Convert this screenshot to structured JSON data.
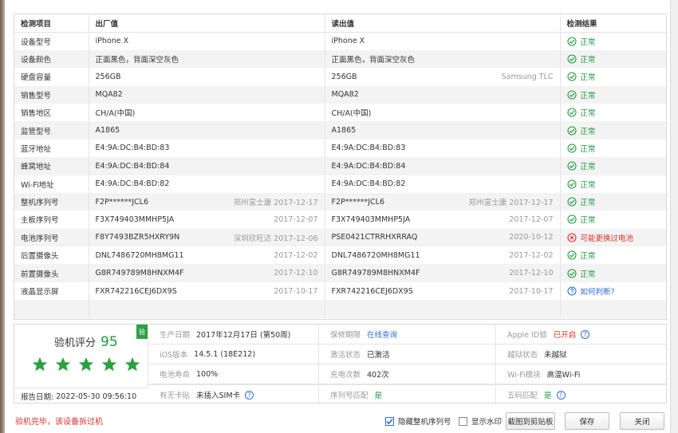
{
  "table": {
    "headers": [
      "检测项目",
      "出厂值",
      "读出值",
      "检测结果"
    ],
    "rows": [
      {
        "item": "设备型号",
        "factory": "iPhone X",
        "factory_note": "",
        "read": "iPhone X",
        "read_note": "",
        "result": "正常",
        "status": "ok"
      },
      {
        "item": "设备颜色",
        "factory": "正面黑色，背面深空灰色",
        "factory_note": "",
        "read": "正面黑色，背面深空灰色",
        "read_note": "",
        "result": "正常",
        "status": "ok"
      },
      {
        "item": "硬盘容量",
        "factory": "256GB",
        "factory_note": "",
        "read": "256GB",
        "read_note": "Samsung TLC",
        "result": "正常",
        "status": "ok"
      },
      {
        "item": "销售型号",
        "factory": "MQA82",
        "factory_note": "",
        "read": "MQA82",
        "read_note": "",
        "result": "正常",
        "status": "ok"
      },
      {
        "item": "销售地区",
        "factory": "CH/A(中国)",
        "factory_note": "",
        "read": "CH/A(中国)",
        "read_note": "",
        "result": "正常",
        "status": "ok"
      },
      {
        "item": "监管型号",
        "factory": "A1865",
        "factory_note": "",
        "read": "A1865",
        "read_note": "",
        "result": "正常",
        "status": "ok"
      },
      {
        "item": "蓝牙地址",
        "factory": "E4:9A:DC:B4:BD:83",
        "factory_note": "",
        "read": "E4:9A:DC:B4:BD:83",
        "read_note": "",
        "result": "正常",
        "status": "ok"
      },
      {
        "item": "蜂窝地址",
        "factory": "E4:9A:DC:B4:BD:84",
        "factory_note": "",
        "read": "E4:9A:DC:B4:BD:84",
        "read_note": "",
        "result": "正常",
        "status": "ok"
      },
      {
        "item": "Wi-Fi地址",
        "factory": "E4:9A:DC:B4:BD:82",
        "factory_note": "",
        "read": "E4:9A:DC:B4:BD:82",
        "read_note": "",
        "result": "正常",
        "status": "ok"
      },
      {
        "item": "整机序列号",
        "factory": "F2P******JCL6",
        "factory_note": "郑州富士康 2017-12-17",
        "read": "F2P******JCL6",
        "read_note": "郑州富士康 2017-12-17",
        "result": "正常",
        "status": "ok"
      },
      {
        "item": "主板序列号",
        "factory": "F3X749403MMHP5JA",
        "factory_note": "2017-12-07",
        "read": "F3X749403MMHP5JA",
        "read_note": "2017-12-07",
        "result": "正常",
        "status": "ok"
      },
      {
        "item": "电池序列号",
        "factory": "F8Y7493BZR5HXRY9N",
        "factory_note": "深圳欣旺达 2017-12-06",
        "read": "PSE0421CTRRHXRRAQ",
        "read_note": "2020-10-12",
        "result": "可能更换过电池",
        "status": "bad"
      },
      {
        "item": "后置摄像头",
        "factory": "DNL7486720MH8MG11",
        "factory_note": "2017-12-02",
        "read": "DNL7486720MH8MG11",
        "read_note": "2017-12-02",
        "result": "正常",
        "status": "ok"
      },
      {
        "item": "前置摄像头",
        "factory": "G8R749789M8HNXM4F",
        "factory_note": "2017-12-10",
        "read": "G8R749789M8HNXM4F",
        "read_note": "2017-12-10",
        "result": "正常",
        "status": "ok"
      },
      {
        "item": "液晶显示屏",
        "factory": "FXR742216CEJ6DX9S",
        "factory_note": "2017-10-17",
        "read": "FXR742216CEJ6DX9S",
        "read_note": "2017-10-17",
        "result": "如何判断?",
        "status": "ask"
      }
    ]
  },
  "score": {
    "label": "验机评分",
    "value": "95",
    "stars": 5,
    "badge": "验"
  },
  "report": {
    "label": "报告日期:",
    "value": "2022-05-30 09:56:10"
  },
  "info": {
    "row1": [
      {
        "key": "生产日期",
        "value": "2017年12月17日 (第50周)",
        "style": ""
      },
      {
        "key": "保修期限",
        "value": "在线查询",
        "style": "blue"
      },
      {
        "key": "Apple ID锁",
        "value": "已开启",
        "style": "red"
      }
    ],
    "row2": [
      {
        "key": "iOS版本",
        "value": "14.5.1 (18E212)",
        "style": ""
      },
      {
        "key": "激活状态",
        "value": "已激活",
        "style": ""
      },
      {
        "key": "越狱状态",
        "value": "未越狱",
        "style": ""
      }
    ],
    "row3": [
      {
        "key": "电池寿命",
        "value": "100%",
        "style": ""
      },
      {
        "key": "充电次数",
        "value": "402次",
        "style": ""
      },
      {
        "key": "Wi-Fi模块",
        "value": "高温Wi-Fi",
        "style": ""
      }
    ],
    "row4": [
      {
        "key": "有无卡贴",
        "value": "未插入SIM卡",
        "style": ""
      },
      {
        "key": "序列号匹配",
        "value": "是",
        "style": "green"
      },
      {
        "key": "五码匹配",
        "value": "是",
        "style": "green"
      }
    ]
  },
  "footer": {
    "message": "验机完毕，该设备拆过机",
    "hide_serial_label": "隐藏整机序列号",
    "hide_serial_checked": true,
    "watermark_label": "显示水印",
    "watermark_checked": false,
    "copy_label": "截图到剪贴板",
    "save_label": "保存",
    "close_label": "关闭"
  },
  "colors": {
    "ok": "#1f9a3c",
    "bad": "#d9302b",
    "link": "#2d6fcf"
  }
}
